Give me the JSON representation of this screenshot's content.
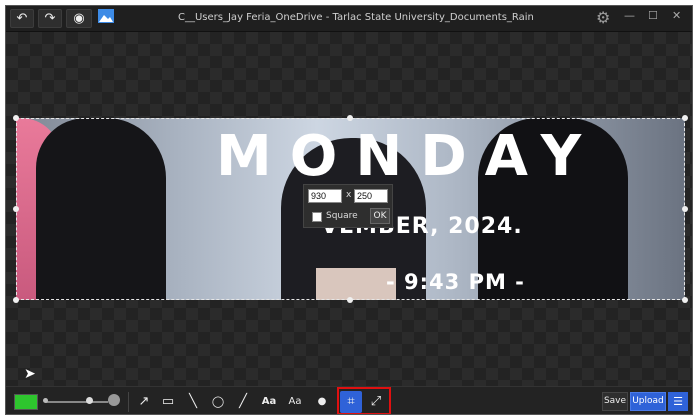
{
  "titlebar": {
    "title": "C__Users_Jay Feria_OneDrive - Tarlac State University_Documents_Rainmeter_Skins_N",
    "undo_icon": "undo-icon",
    "redo_icon": "redo-icon",
    "camera_icon": "camera-eye-icon",
    "image_icon": "image-icon",
    "settings_icon": "gear-icon",
    "minimize_glyph": "—",
    "maximize_glyph": "☐",
    "close_glyph": "✕"
  },
  "banner": {
    "heading": "MONDAY",
    "date_line": "VEMBER, 2024.",
    "time_line": "- 9:43 PM -"
  },
  "crop_panel": {
    "width_value": "930",
    "height_value": "250",
    "separator": "x",
    "square_label": "Square",
    "square_checked": false,
    "ok_label": "OK"
  },
  "toolbar": {
    "color": "#2ec52e",
    "save_label": "Save",
    "upload_label": "Upload",
    "tools": [
      {
        "name": "arrow-tool",
        "glyph": "↗"
      },
      {
        "name": "rectangle-tool",
        "glyph": "▭"
      },
      {
        "name": "line-tool",
        "glyph": "╲"
      },
      {
        "name": "ellipse-tool",
        "glyph": "◯"
      },
      {
        "name": "pen-tool",
        "glyph": "╱"
      },
      {
        "name": "text-tool",
        "glyph": "Aa"
      },
      {
        "name": "text-outline-tool",
        "glyph": "Aa"
      },
      {
        "name": "blur-tool",
        "glyph": "●"
      },
      {
        "name": "crop-tool",
        "glyph": "⌗"
      },
      {
        "name": "resize-tool",
        "glyph": "⤢"
      }
    ]
  },
  "colors": {
    "accent": "#2f62d8",
    "highlight": "#e01010"
  }
}
